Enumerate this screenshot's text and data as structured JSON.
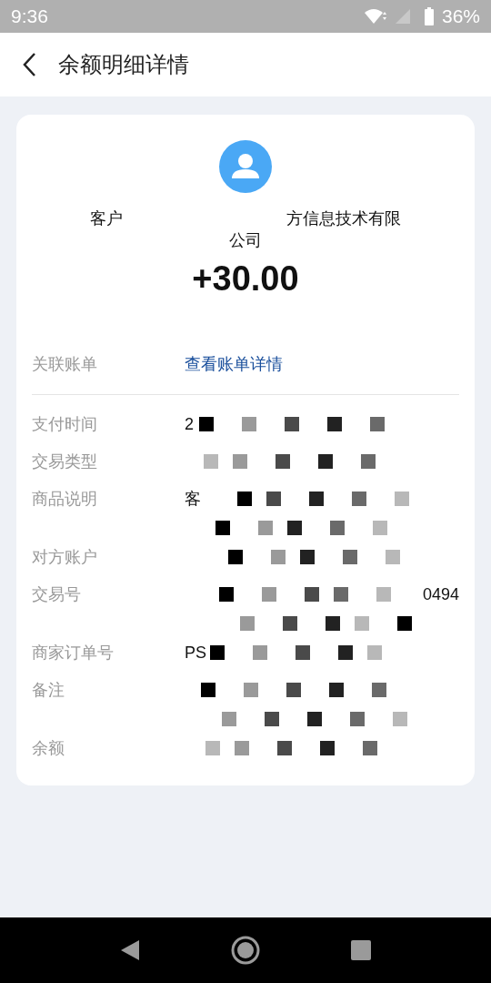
{
  "status_bar": {
    "time": "9:36",
    "battery": "36%"
  },
  "header": {
    "title": "余额明细详情"
  },
  "summary": {
    "name_parts": [
      "客户",
      "方信息技术有限",
      "公司"
    ],
    "amount": "+30.00"
  },
  "linked_bill": {
    "label": "关联账单",
    "link": "查看账单详情"
  },
  "details": [
    {
      "label": "支付时间",
      "value": "2",
      "wrapped": false
    },
    {
      "label": "交易类型",
      "wrapped": false
    },
    {
      "label": "商品说明",
      "value": "客",
      "wrapped": true
    },
    {
      "label": "对方账户",
      "wrapped": false
    },
    {
      "label": "交易号",
      "value": "0494",
      "value_end": true,
      "wrapped": true
    },
    {
      "label": "商家订单号",
      "value": "PS",
      "wrapped": false
    },
    {
      "label": "备注",
      "wrapped": true
    },
    {
      "label": "余额",
      "wrapped": false
    }
  ]
}
